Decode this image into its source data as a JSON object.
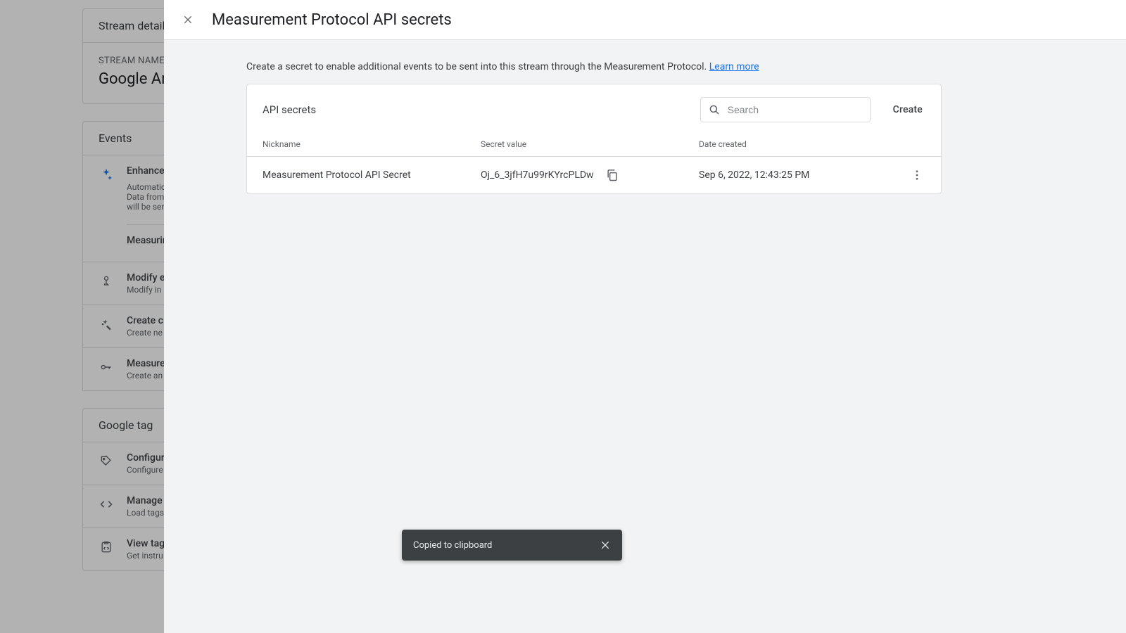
{
  "back": {
    "stream_details": "Stream details",
    "stream_name_label": "STREAM NAME",
    "stream_name_value": "Google Ana",
    "events_title": "Events",
    "enhanced_title": "Enhance",
    "enhanced_l1": "Automatic",
    "enhanced_l2": "Data from",
    "enhanced_l3": "will be ser",
    "enhanced_measuring": "Measurin",
    "modify_title": "Modify e",
    "modify_sub": "Modify in",
    "create_title": "Create c",
    "create_sub": "Create ne",
    "measure_title": "Measure",
    "measure_sub": "Create an",
    "gtag_title": "Google tag",
    "configure_title": "Configur",
    "configure_sub": "Configure",
    "manage_title": "Manage",
    "manage_sub": "Load tags",
    "view_title": "View tag",
    "view_sub": "Get instru"
  },
  "drawer": {
    "title": "Measurement Protocol API secrets",
    "intro": "Create a secret to enable additional events to be sent into this stream through the Measurement Protocol. ",
    "learn_more": "Learn more",
    "card_title": "API secrets",
    "search_placeholder": "Search",
    "create_label": "Create",
    "cols": {
      "nickname": "Nickname",
      "secret": "Secret value",
      "date": "Date created"
    },
    "rows": [
      {
        "nickname": "Measurement Protocol API Secret",
        "secret": "Oj_6_3jfH7u99rKYrcPLDw",
        "date": "Sep 6, 2022, 12:43:25 PM"
      }
    ]
  },
  "toast": {
    "message": "Copied to clipboard"
  }
}
